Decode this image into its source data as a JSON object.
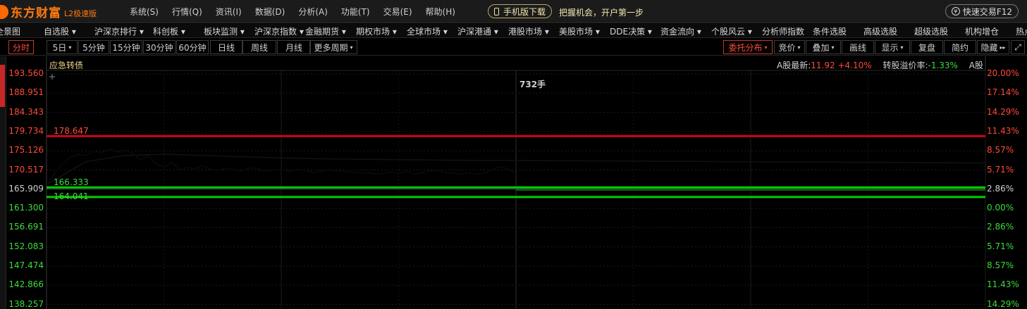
{
  "app": {
    "brand": "东方财富",
    "version": "L2极速版"
  },
  "menu": [
    "系统(S)",
    "行情(Q)",
    "资讯(I)",
    "数据(D)",
    "分析(A)",
    "功能(T)",
    "交易(E)",
    "帮助(H)"
  ],
  "mobile_download": "手机版下载",
  "slogan": "把握机会，开户第一步",
  "quick_trade": "快速交易F12",
  "nav": [
    {
      "label": "全景图",
      "dd": false
    },
    {
      "label": "自选股",
      "dd": true
    },
    {
      "label": "沪深京排行",
      "dd": true
    },
    {
      "label": "科创板",
      "dd": true
    },
    {
      "label": "板块监测",
      "dd": true
    },
    {
      "label": "沪深京指数",
      "dd": true
    },
    {
      "label": "金融期货",
      "dd": true
    },
    {
      "label": "期权市场",
      "dd": true
    },
    {
      "label": "全球市场",
      "dd": true
    },
    {
      "label": "沪深港通",
      "dd": true
    },
    {
      "label": "港股市场",
      "dd": true
    },
    {
      "label": "美股市场",
      "dd": true
    },
    {
      "label": "DDE决策",
      "dd": true
    },
    {
      "label": "资金流向",
      "dd": true
    },
    {
      "label": "个股风云",
      "dd": true
    },
    {
      "label": "分析师指数",
      "dd": false
    },
    {
      "label": "条件选股",
      "dd": false
    },
    {
      "label": "高级选股",
      "dd": false
    },
    {
      "label": "超级选股",
      "dd": false
    },
    {
      "label": "机构增仓",
      "dd": false
    },
    {
      "label": "热点",
      "dd": false
    }
  ],
  "periods": [
    "分时",
    "5日",
    "5分钟",
    "15分钟",
    "30分钟",
    "60分钟",
    "日线",
    "周线",
    "月线",
    "更多周期"
  ],
  "right_tools": [
    "委托分布",
    "竞价",
    "叠加",
    "画线",
    "显示",
    "复盘",
    "简约",
    "隐藏"
  ],
  "chart": {
    "title": "应急转债",
    "a_label": "A股最新:",
    "a_price": "11.92",
    "a_change": "+4.10%",
    "premium_label": "转股溢价率:",
    "premium_value": "-1.33%",
    "a_suffix": "A股",
    "volume_label": "732手",
    "level_red": "178.647",
    "level_green_upper": "166.333",
    "level_green_lower": "164.041"
  },
  "chart_data": {
    "type": "line",
    "title": "应急转债",
    "y_ticks": [
      "193.560",
      "188.951",
      "184.343",
      "179.734",
      "175.126",
      "170.517",
      "165.909",
      "161.300",
      "156.691",
      "152.083",
      "147.474",
      "142.866",
      "138.257"
    ],
    "pct_ticks": [
      "20.00%",
      "17.14%",
      "14.29%",
      "11.43%",
      "8.57%",
      "5.71%",
      "2.86%",
      "0.00%",
      "2.86%",
      "5.71%",
      "8.57%",
      "11.43%",
      "14.29%"
    ],
    "ylim": [
      138.257,
      193.56
    ],
    "prev_close": 161.3,
    "horizontal_levels": [
      {
        "value": 178.647,
        "color": "#d0021b"
      },
      {
        "value": 166.333,
        "color": "#00d000"
      },
      {
        "value": 164.041,
        "color": "#00d000"
      }
    ],
    "price_series": {
      "name": "",
      "x": [
        0,
        2,
        4,
        6,
        8,
        10,
        12,
        14,
        16,
        18,
        20,
        22,
        24,
        26,
        28,
        30,
        32,
        34,
        36,
        38,
        40,
        42,
        44,
        46,
        48,
        50,
        52,
        54,
        56,
        58,
        60,
        62,
        64,
        66,
        68,
        70,
        72,
        74,
        76,
        78,
        80,
        82,
        84,
        86,
        88,
        90,
        92,
        94,
        96,
        98,
        100,
        102,
        104,
        106,
        108,
        110,
        112,
        114,
        116,
        118,
        120
      ],
      "values": [
        167.0,
        169.5,
        172.0,
        173.5,
        174.2,
        174.0,
        175.0,
        174.6,
        175.6,
        174.8,
        175.3,
        174.5,
        173.0,
        173.9,
        172.0,
        171.2,
        172.3,
        170.6,
        171.1,
        170.8,
        171.6,
        170.6,
        170.4,
        171.0,
        170.6,
        170.3,
        171.0,
        170.9,
        170.1,
        170.5,
        170.6,
        170.2,
        170.7,
        170.4,
        169.9,
        170.1,
        170.6,
        170.3,
        170.1,
        170.0,
        169.8,
        169.9,
        169.6,
        169.7,
        170.1,
        169.6,
        170.2,
        169.5,
        169.8,
        170.3,
        170.4,
        169.9,
        169.7,
        169.5,
        169.8,
        169.6,
        169.7,
        170.6,
        171.3,
        170.8,
        169.6
      ]
    },
    "avg_series": {
      "name": "",
      "x": [
        0,
        10,
        20,
        30,
        40,
        50,
        60,
        70,
        80,
        90,
        100,
        110,
        120,
        140,
        160,
        180,
        200,
        220,
        240
      ],
      "values": [
        167.0,
        172.5,
        174.0,
        174.3,
        174.0,
        173.7,
        173.4,
        173.2,
        173.1,
        173.0,
        172.9,
        172.8,
        172.8,
        172.7,
        172.6,
        172.5,
        172.4,
        172.3,
        172.2
      ]
    },
    "x_range": [
      0,
      240
    ],
    "grid": true,
    "volume_label": "732手"
  },
  "colors": {
    "up": "#ff4a3a",
    "down": "#3ddc3d",
    "accent": "#ff7a10",
    "title": "#e8d28a"
  }
}
